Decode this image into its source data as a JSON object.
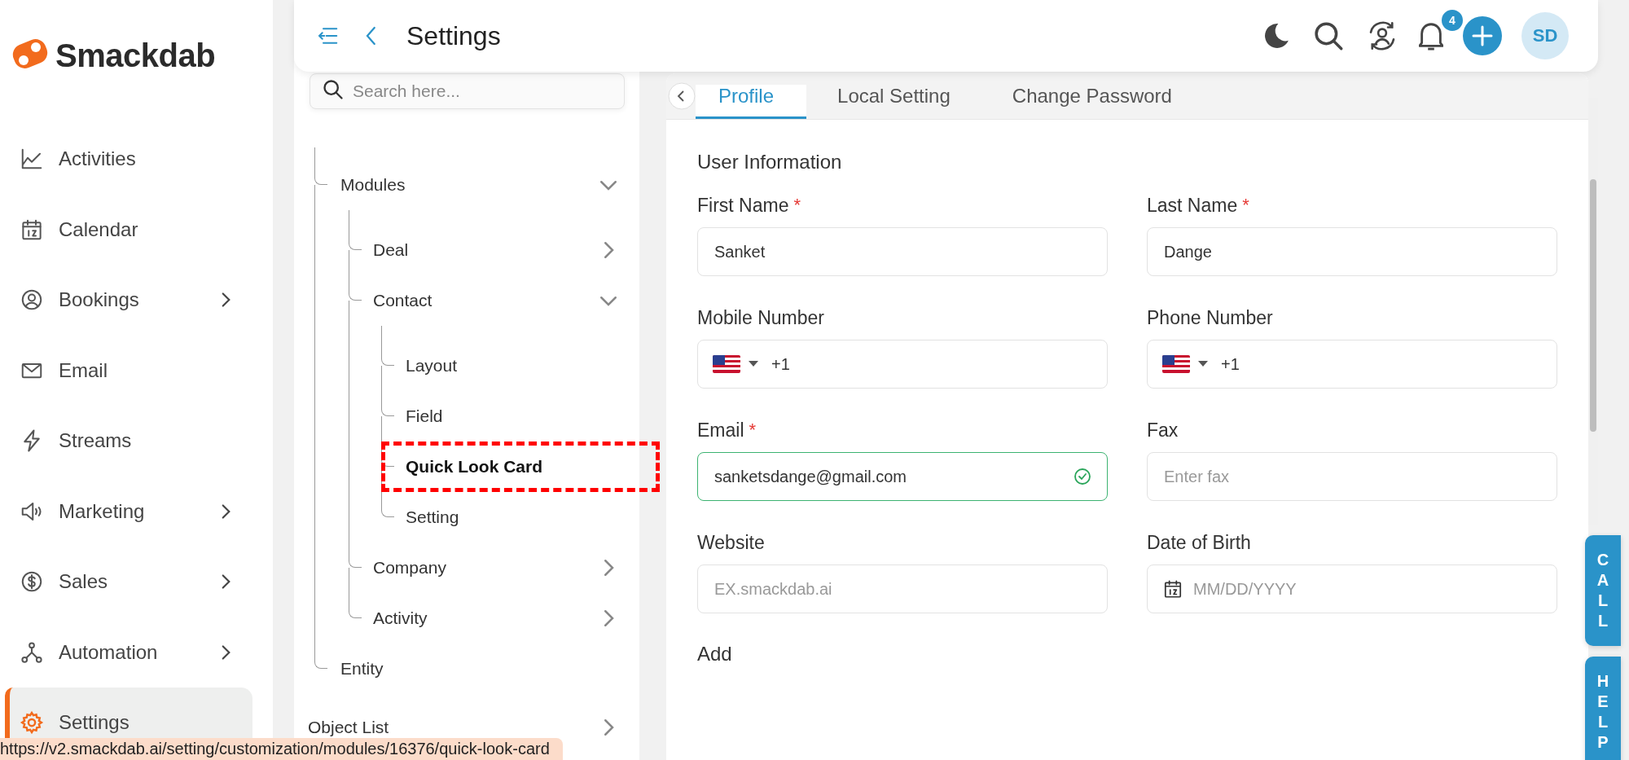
{
  "sidebar": {
    "logo": "Smackdab",
    "items": [
      {
        "label": "Activities",
        "expandable": false,
        "selected": false
      },
      {
        "label": "Calendar",
        "expandable": false,
        "selected": false
      },
      {
        "label": "Bookings",
        "expandable": true,
        "selected": false
      },
      {
        "label": "Email",
        "expandable": false,
        "selected": false
      },
      {
        "label": "Streams",
        "expandable": false,
        "selected": false
      },
      {
        "label": "Marketing",
        "expandable": true,
        "selected": false
      },
      {
        "label": "Sales",
        "expandable": true,
        "selected": false
      },
      {
        "label": "Automation",
        "expandable": true,
        "selected": false
      },
      {
        "label": "Settings",
        "expandable": false,
        "selected": true
      }
    ]
  },
  "header": {
    "title": "Settings",
    "notification_count": "4",
    "avatar": "SD"
  },
  "tree": {
    "search": {
      "placeholder": "Search here..."
    },
    "items": [
      {
        "label": "Modules",
        "expanded": true,
        "selected": false,
        "children": [
          {
            "label": "Deal",
            "expanded": false,
            "selected": false
          },
          {
            "label": "Contact",
            "expanded": true,
            "selected": false,
            "children": [
              {
                "label": "Layout",
                "selected": false
              },
              {
                "label": "Field",
                "selected": false
              },
              {
                "label": "Quick Look Card",
                "selected": true
              },
              {
                "label": "Setting",
                "selected": false
              }
            ]
          },
          {
            "label": "Company",
            "expanded": false,
            "selected": false
          },
          {
            "label": "Activity",
            "expanded": false,
            "selected": false
          }
        ]
      },
      {
        "label": "Entity",
        "selected": false
      }
    ],
    "object_list": {
      "label": "Object List"
    }
  },
  "tabs": [
    {
      "label": "Profile",
      "selected": true
    },
    {
      "label": "Local Setting",
      "selected": false
    },
    {
      "label": "Change Password",
      "selected": false
    }
  ],
  "form": {
    "section": "User Information",
    "required_mark": "*",
    "fields": [
      {
        "kind": "text",
        "label": "First Name",
        "required": true,
        "value": "Sanket"
      },
      {
        "kind": "text",
        "label": "Last Name",
        "required": true,
        "value": "Dange"
      },
      {
        "kind": "phone",
        "label": "Mobile Number",
        "required": false,
        "value": "+1"
      },
      {
        "kind": "phone",
        "label": "Phone Number",
        "required": false,
        "value": "+1"
      },
      {
        "kind": "text",
        "label": "Email",
        "required": true,
        "value": "sanketsdange@gmail.com",
        "valid": true
      },
      {
        "kind": "text",
        "label": "Fax",
        "required": false,
        "placeholder": "Enter fax"
      },
      {
        "kind": "text",
        "label": "Website",
        "required": false,
        "placeholder": "EX.smackdab.ai"
      },
      {
        "kind": "date",
        "label": "Date of Birth",
        "required": false,
        "placeholder": "MM/DD/YYYY"
      }
    ],
    "next_section": "Add"
  },
  "side_tabs": [
    "CALL",
    "HELP"
  ],
  "status_bar": {
    "url": "https://v2.smackdab.ai/setting/customization/modules/16376/quick-look-card"
  }
}
